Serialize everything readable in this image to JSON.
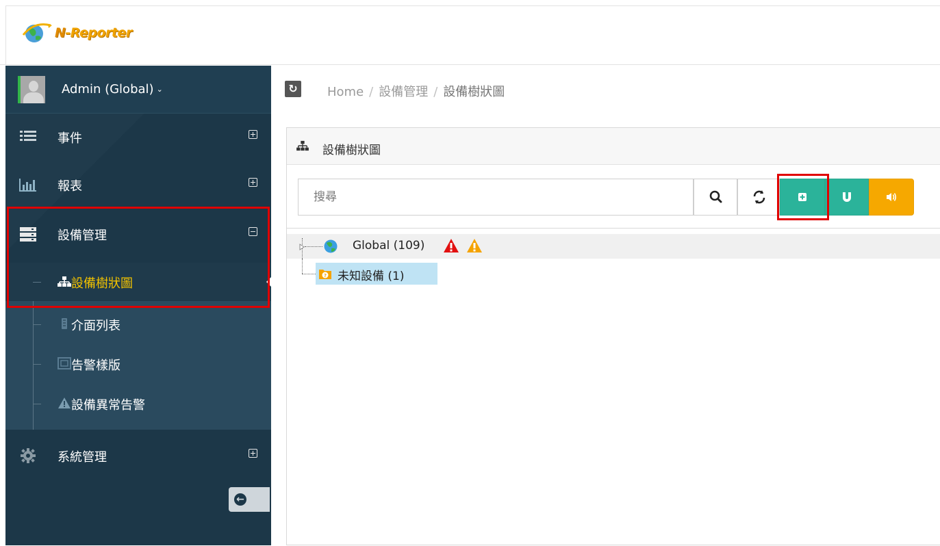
{
  "app": {
    "logo_text_n": "N",
    "logo_text_rest": "-Reporter"
  },
  "sidebar": {
    "user_label": "Admin (Global)",
    "items": [
      {
        "label": "事件",
        "icon": "list-icon"
      },
      {
        "label": "報表",
        "icon": "bar-chart-icon"
      },
      {
        "label": "設備管理",
        "icon": "server-icon"
      },
      {
        "label": "系統管理",
        "icon": "gear-icon"
      }
    ],
    "subitems": [
      {
        "label": "設備樹狀圖",
        "icon": "sitemap-icon",
        "active": true
      },
      {
        "label": "介面列表",
        "icon": "interface-icon"
      },
      {
        "label": "告警樣版",
        "icon": "template-icon"
      },
      {
        "label": "設備異常告警",
        "icon": "warning-icon"
      }
    ]
  },
  "breadcrumb": {
    "home": "Home",
    "section": "設備管理",
    "current": "設備樹狀圖"
  },
  "panel": {
    "title": "設備樹狀圖",
    "search_placeholder": "搜尋"
  },
  "tree": {
    "nodes": [
      {
        "label": "Global (109)",
        "icon": "globe-icon"
      },
      {
        "label": "未知設備 (1)",
        "icon": "unknown-folder-icon",
        "selected": true
      }
    ]
  },
  "colors": {
    "sidebar_bg": "#1c3748",
    "active_text": "#f2c200",
    "add_button": "#2bb39a",
    "sound_button": "#f6a800",
    "highlight": "#e00000"
  }
}
